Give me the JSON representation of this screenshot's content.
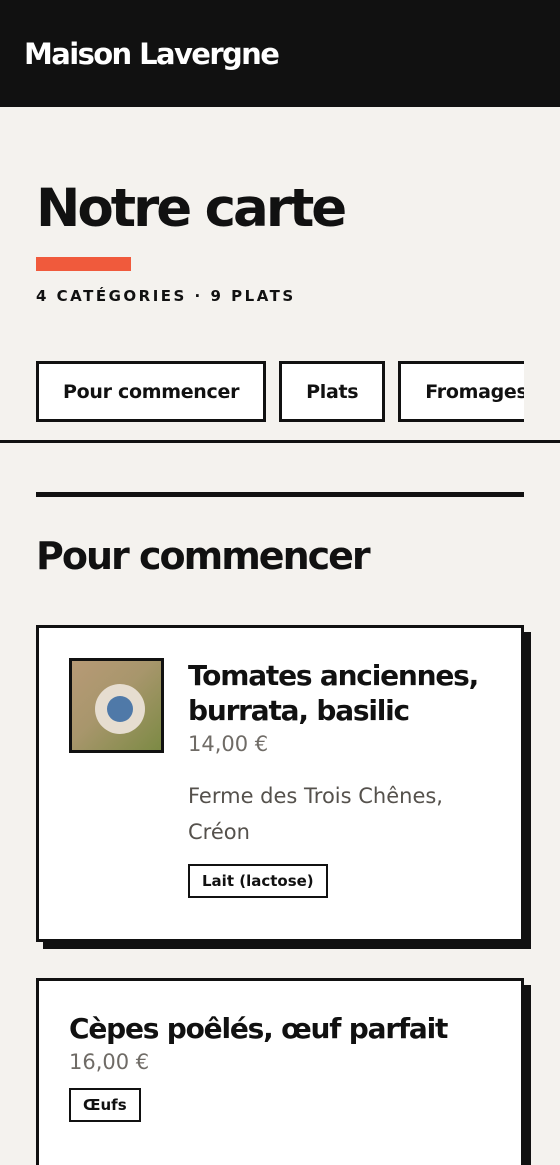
{
  "header": {
    "brand": "Maison Lavergne"
  },
  "hero": {
    "title": "Notre carte",
    "meta": "4 CATÉGORIES · 9 PLATS",
    "accent_color": "#f05a3c"
  },
  "tabs": [
    {
      "label": "Pour commencer"
    },
    {
      "label": "Plats"
    },
    {
      "label": "Fromages"
    }
  ],
  "section": {
    "title": "Pour commencer",
    "items": [
      {
        "name": "Tomates anciennes, burrata, basilic",
        "price": "14,00 €",
        "origin": "Ferme des Trois Chênes, Créon",
        "allergen": "Lait (lactose)",
        "has_image": true
      },
      {
        "name": "Cèpes poêlés, œuf parfait",
        "price": "16,00 €",
        "allergen": "Œufs",
        "has_image": false
      }
    ]
  }
}
